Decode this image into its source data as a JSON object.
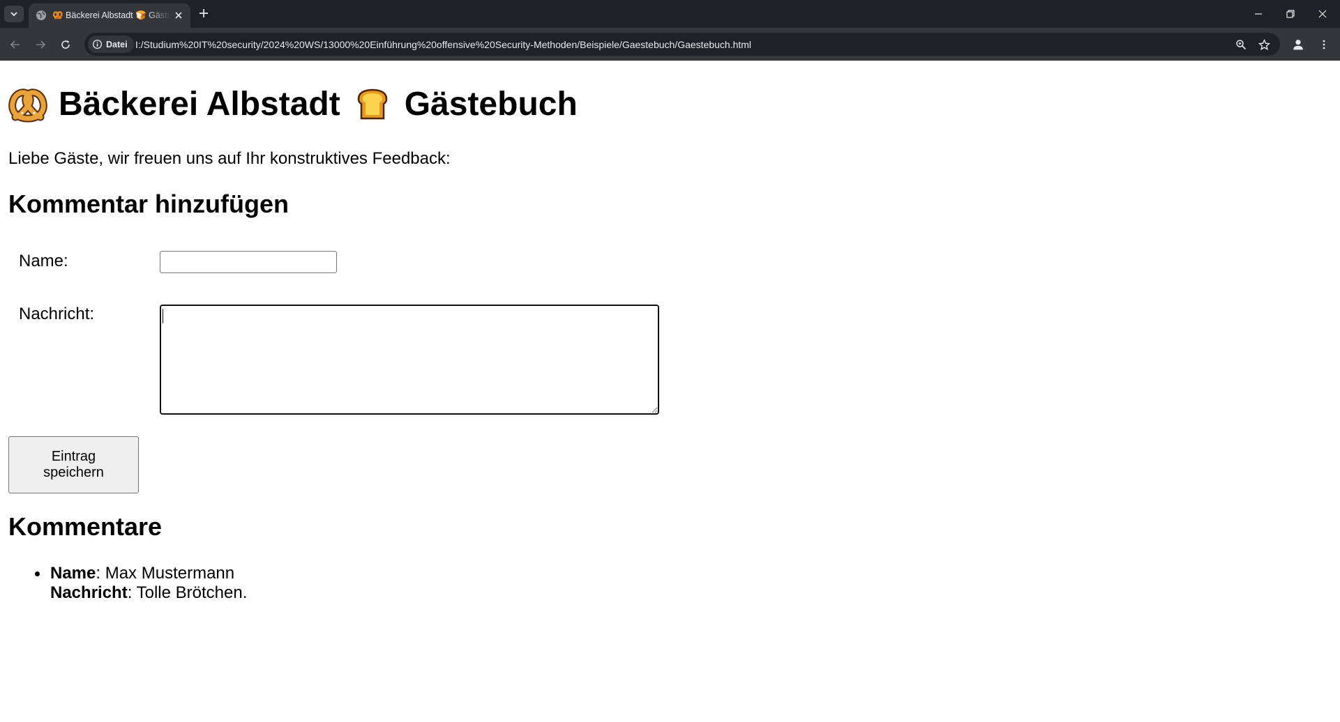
{
  "browser": {
    "tab_title": "🥨 Bäckerei Albstadt 🍞 Gästebuch",
    "site_info_label": "Datei",
    "url": "I:/Studium%20IT%20security/2024%20WS/13000%20Einführung%20offensive%20Security-Methoden/Beispiele/Gaestebuch/Gaestebuch.html",
    "icons": [
      "tab-search-icon",
      "globe-icon",
      "close-icon",
      "plus-icon",
      "back-arrow-icon",
      "forward-arrow-icon",
      "reload-icon",
      "info-icon",
      "zoom-icon",
      "star-icon",
      "profile-icon",
      "kebab-menu-icon",
      "minimize-icon",
      "restore-icon",
      "window-close-icon"
    ]
  },
  "page": {
    "title_part1": "Bäckerei Albstadt",
    "title_part2": "Gästebuch",
    "title_icons": [
      "pretzel-icon",
      "bread-icon"
    ],
    "intro": "Liebe Gäste, wir freuen uns auf Ihr konstruktives Feedback:",
    "form": {
      "heading": "Kommentar hinzufügen",
      "name_label": "Name:",
      "name_value": "",
      "message_label": "Nachricht:",
      "message_value": "",
      "submit_label": "Eintrag speichern"
    },
    "comments": {
      "heading": "Kommentare",
      "name_key": "Name",
      "message_key": "Nachricht",
      "items": [
        {
          "name": "Max Mustermann",
          "message": "Tolle Brötchen."
        }
      ]
    }
  }
}
